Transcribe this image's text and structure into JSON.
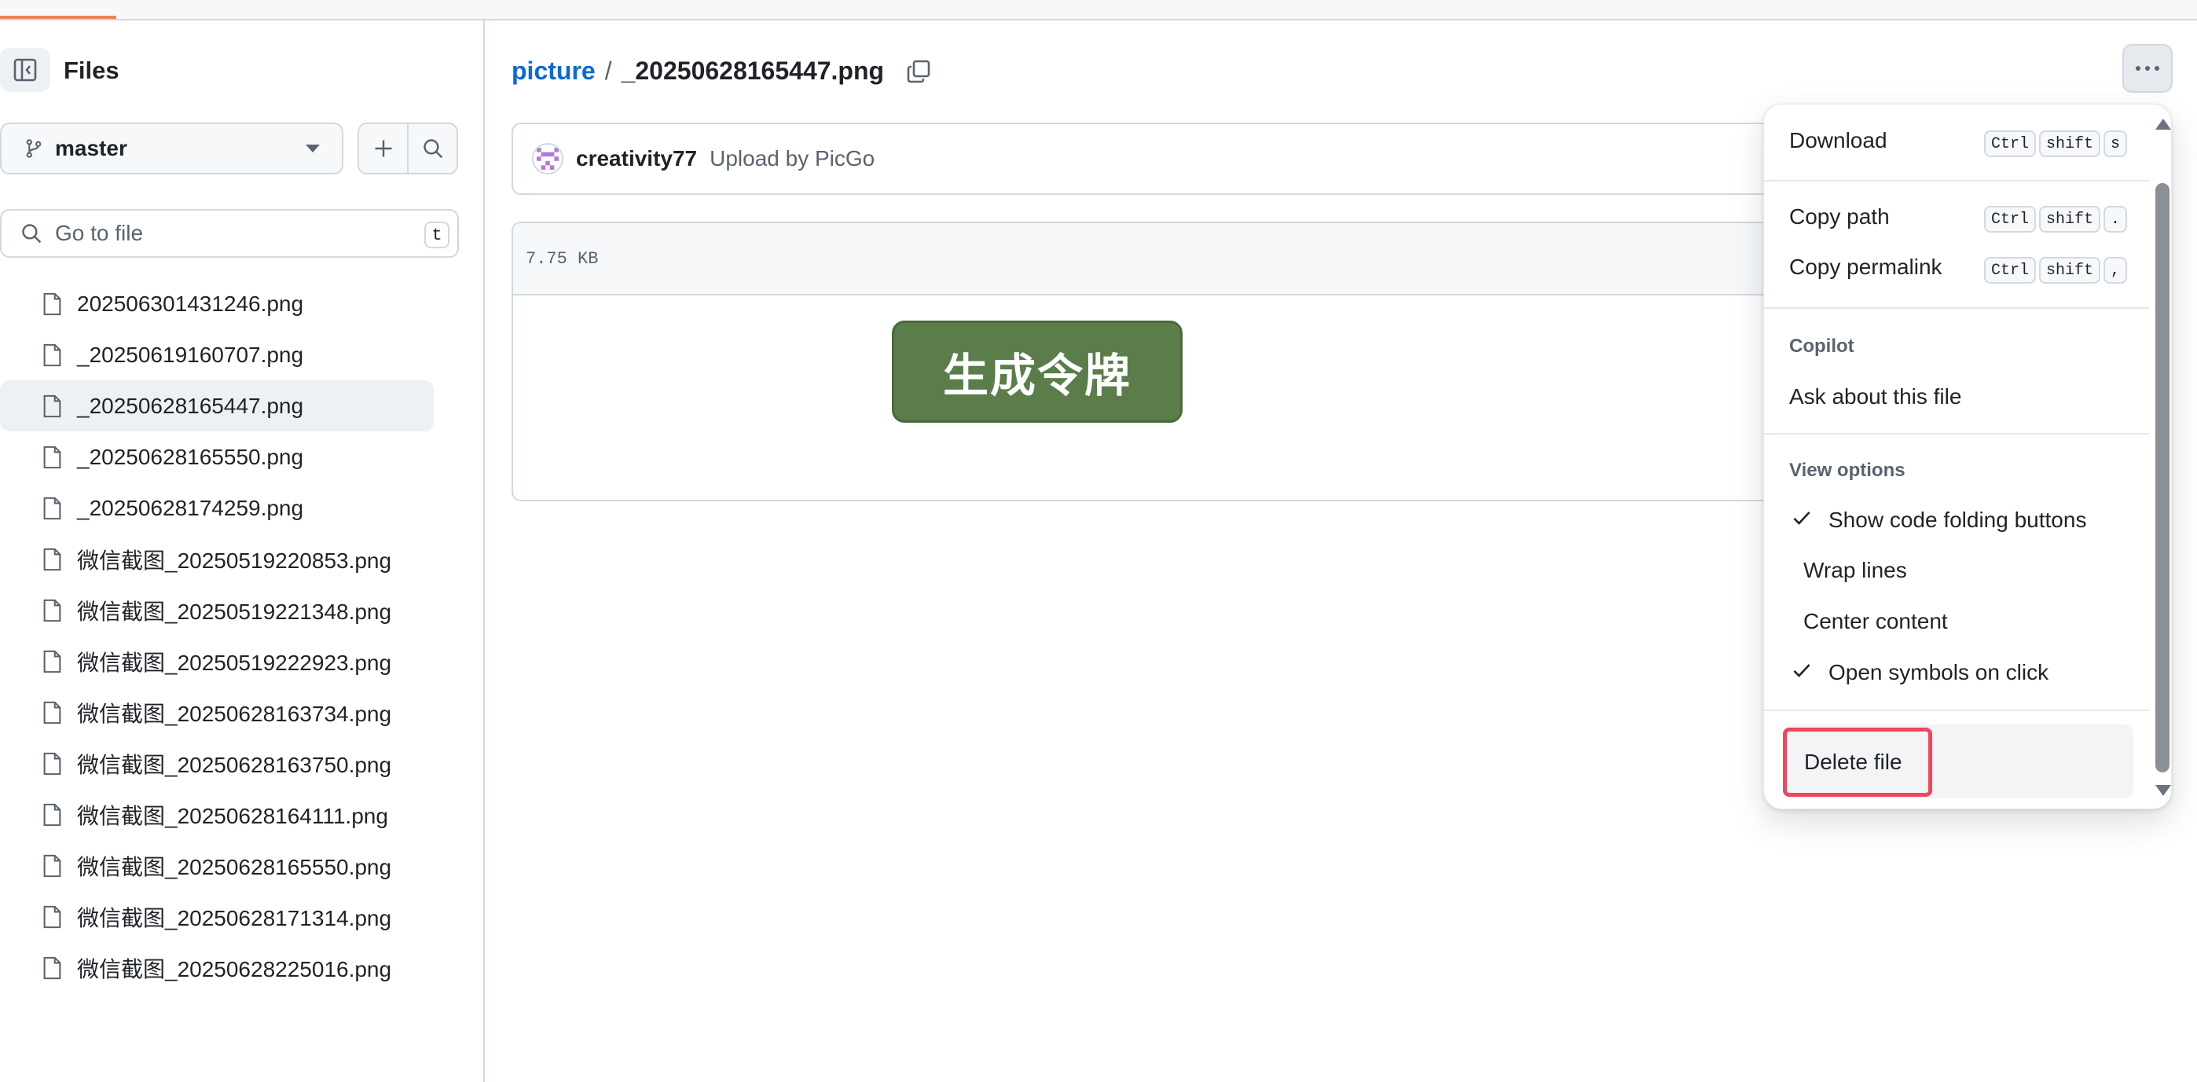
{
  "sidebar": {
    "title": "Files",
    "branch": "master",
    "search_placeholder": "Go to file",
    "search_shortcut": "t",
    "files": [
      "202506301431246.png",
      "_20250619160707.png",
      "_20250628165447.png",
      "_20250628165550.png",
      "_20250628174259.png",
      "微信截图_20250519220853.png",
      "微信截图_20250519221348.png",
      "微信截图_20250519222923.png",
      "微信截图_20250628163734.png",
      "微信截图_20250628163750.png",
      "微信截图_20250628164111.png",
      "微信截图_20250628165550.png",
      "微信截图_20250628171314.png",
      "微信截图_20250628225016.png"
    ],
    "active_file": "_20250628165447.png"
  },
  "breadcrumb": {
    "repo": "picture",
    "separator": "/",
    "file": "_20250628165447.png"
  },
  "commit": {
    "author": "creativity77",
    "message": "Upload by PicGo"
  },
  "file_box": {
    "size": "7.75 KB",
    "preview_text": "生成令牌",
    "preview_color": "#5a7d4a"
  },
  "menu": {
    "download": {
      "label": "Download",
      "keys": [
        "Ctrl",
        "shift",
        "s"
      ]
    },
    "copy_path": {
      "label": "Copy path",
      "keys": [
        "Ctrl",
        "shift",
        "."
      ]
    },
    "copy_permalink": {
      "label": "Copy permalink",
      "keys": [
        "Ctrl",
        "shift",
        ","
      ]
    },
    "copilot_heading": "Copilot",
    "ask_copilot": "Ask about this file",
    "view_options_heading": "View options",
    "show_folding": "Show code folding buttons",
    "wrap_lines": "Wrap lines",
    "center_content": "Center content",
    "open_symbols": "Open symbols on click",
    "delete_file": "Delete file",
    "highlight_color": "#f0455e"
  },
  "colors": {
    "link": "#0969da",
    "border": "#d1d9e0",
    "accent_progress": "#e8825a"
  }
}
